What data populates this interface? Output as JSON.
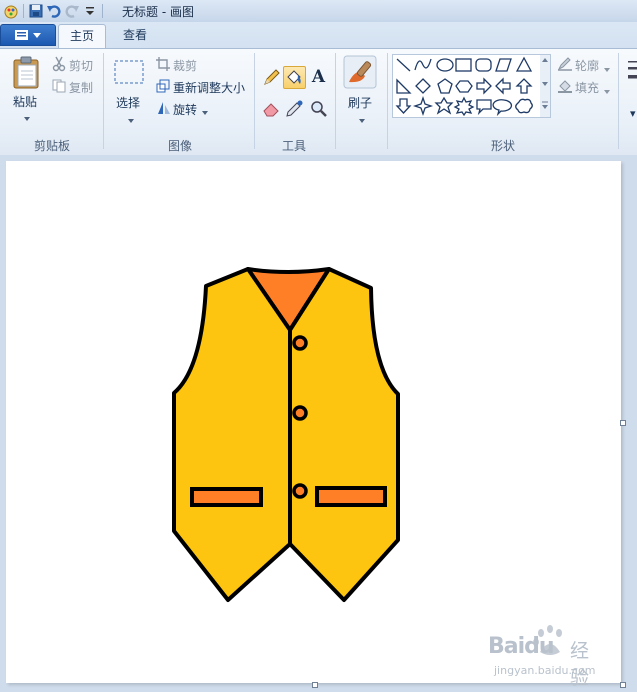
{
  "window": {
    "title": "无标题 - 画图"
  },
  "tabs": {
    "home": "主页",
    "view": "查看"
  },
  "clipboard": {
    "paste": "粘贴",
    "cut": "剪切",
    "copy": "复制",
    "group": "剪贴板"
  },
  "image": {
    "select": "选择",
    "crop": "裁剪",
    "resize": "重新调整大小",
    "rotate": "旋转",
    "group": "图像"
  },
  "tools": {
    "group": "工具",
    "text_glyph": "A"
  },
  "brushes": {
    "label": "刷子"
  },
  "shapes": {
    "outline": "轮廓",
    "fill": "填充",
    "group": "形状"
  },
  "watermark": {
    "brand": "Baidu",
    "sub": "经验",
    "url": "jingyan.baidu.com"
  },
  "colors": {
    "vest_fill": "#fdc50f",
    "collar_fill": "#ff7f27",
    "outline": "#000000",
    "canvas": "#ffffff",
    "workspace": "#cfdcec"
  },
  "canvas_drawing": {
    "subject": "vest",
    "buttons": 3,
    "pockets": 2
  }
}
